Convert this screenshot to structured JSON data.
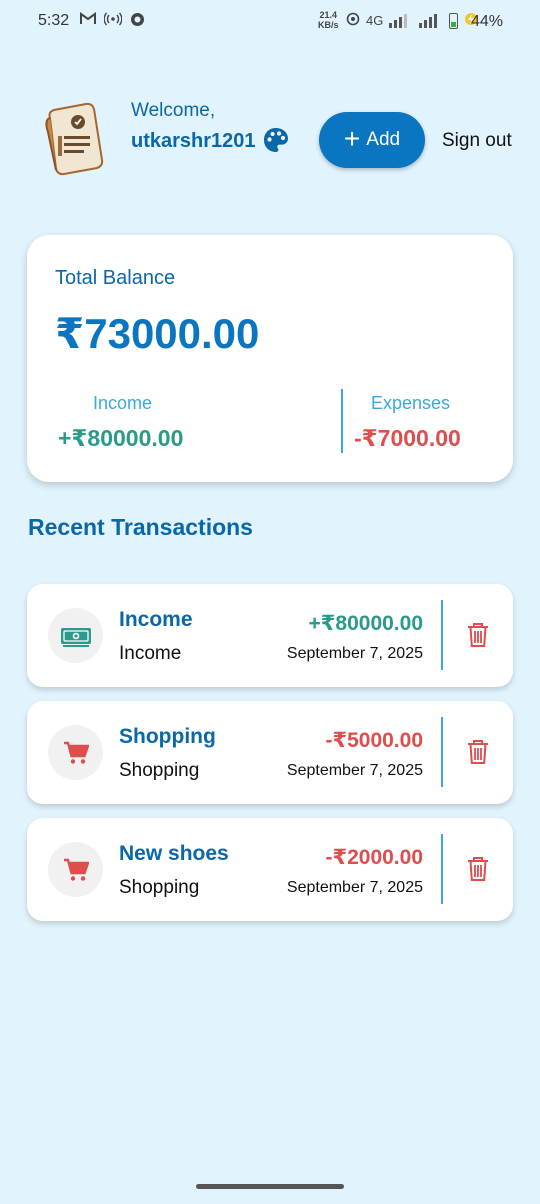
{
  "status_bar": {
    "time": "5:32",
    "speed_value": "21.4",
    "speed_unit": "KB/s",
    "network": "4G",
    "battery": "44%"
  },
  "header": {
    "welcome": "Welcome,",
    "username": "utkarshr1201",
    "add_label": "Add",
    "signout_label": "Sign out"
  },
  "balance": {
    "title": "Total Balance",
    "total": "₹73000.00",
    "income_label": "Income",
    "income_value": "+₹80000.00",
    "expenses_label": "Expenses",
    "expenses_value": "-₹7000.00"
  },
  "recent": {
    "title": "Recent Transactions",
    "items": [
      {
        "title": "Income",
        "category": "Income",
        "amount": "+₹80000.00",
        "date": "September 7, 2025",
        "icon": "money-icon",
        "kind": "income"
      },
      {
        "title": "Shopping",
        "category": "Shopping",
        "amount": "-₹5000.00",
        "date": "September 7, 2025",
        "icon": "cart-icon",
        "kind": "expense"
      },
      {
        "title": "New shoes",
        "category": "Shopping",
        "amount": "-₹2000.00",
        "date": "September 7, 2025",
        "icon": "cart-icon",
        "kind": "expense"
      }
    ]
  },
  "colors": {
    "background": "#e1f3fd",
    "primary": "#0a75c0",
    "income": "#2a9a8a",
    "expense": "#df4d4d",
    "accent_light": "#3aa9de"
  }
}
